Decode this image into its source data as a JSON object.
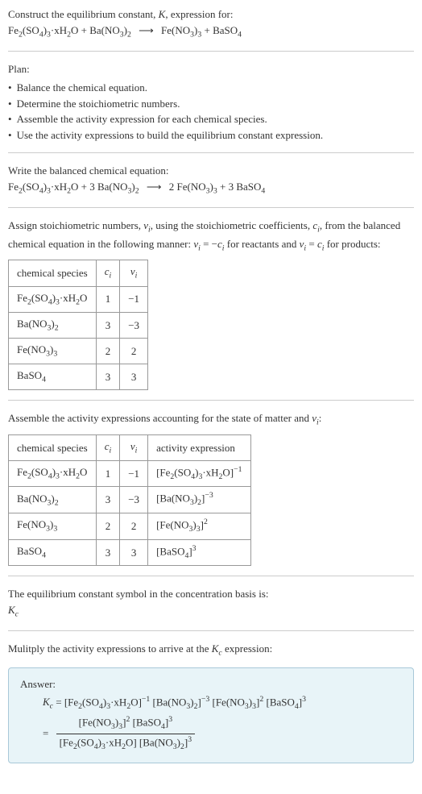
{
  "intro": {
    "line1": "Construct the equilibrium constant, K, expression for:",
    "equation_left": "Fe₂(SO₄)₃·xH₂O + Ba(NO₃)₂",
    "arrow": "⟶",
    "equation_right": "Fe(NO₃)₃ + BaSO₄"
  },
  "plan": {
    "title": "Plan:",
    "items": [
      "Balance the chemical equation.",
      "Determine the stoichiometric numbers.",
      "Assemble the activity expression for each chemical species.",
      "Use the activity expressions to build the equilibrium constant expression."
    ]
  },
  "balanced": {
    "title": "Write the balanced chemical equation:",
    "left": "Fe₂(SO₄)₃·xH₂O + 3 Ba(NO₃)₂",
    "arrow": "⟶",
    "right": "2 Fe(NO₃)₃ + 3 BaSO₄"
  },
  "stoich": {
    "text": "Assign stoichiometric numbers, νᵢ, using the stoichiometric coefficients, cᵢ, from the balanced chemical equation in the following manner: νᵢ = −cᵢ for reactants and νᵢ = cᵢ for products:",
    "headers": [
      "chemical species",
      "cᵢ",
      "νᵢ"
    ],
    "rows": [
      [
        "Fe₂(SO₄)₃·xH₂O",
        "1",
        "−1"
      ],
      [
        "Ba(NO₃)₂",
        "3",
        "−3"
      ],
      [
        "Fe(NO₃)₃",
        "2",
        "2"
      ],
      [
        "BaSO₄",
        "3",
        "3"
      ]
    ]
  },
  "activity": {
    "text": "Assemble the activity expressions accounting for the state of matter and νᵢ:",
    "headers": [
      "chemical species",
      "cᵢ",
      "νᵢ",
      "activity expression"
    ],
    "rows": [
      [
        "Fe₂(SO₄)₃·xH₂O",
        "1",
        "−1",
        "[Fe₂(SO₄)₃·xH₂O]⁻¹"
      ],
      [
        "Ba(NO₃)₂",
        "3",
        "−3",
        "[Ba(NO₃)₂]⁻³"
      ],
      [
        "Fe(NO₃)₃",
        "2",
        "2",
        "[Fe(NO₃)₃]²"
      ],
      [
        "BaSO₄",
        "3",
        "3",
        "[BaSO₄]³"
      ]
    ]
  },
  "symbol": {
    "text": "The equilibrium constant symbol in the concentration basis is:",
    "value": "K𝒸"
  },
  "multiply": {
    "text": "Mulitply the activity expressions to arrive at the K𝒸 expression:"
  },
  "answer": {
    "label": "Answer:",
    "line1": "K𝒸 = [Fe₂(SO₄)₃·xH₂O]⁻¹ [Ba(NO₃)₂]⁻³ [Fe(NO₃)₃]² [BaSO₄]³",
    "eq": "=",
    "frac_num": "[Fe(NO₃)₃]² [BaSO₄]³",
    "frac_den": "[Fe₂(SO₄)₃·xH₂O] [Ba(NO₃)₂]³"
  }
}
